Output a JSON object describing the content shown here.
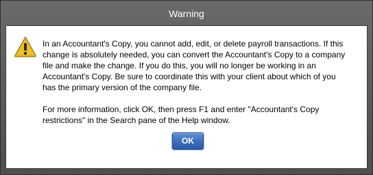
{
  "window": {
    "title": "Warning"
  },
  "icon": {
    "name": "warning-icon",
    "color": "#e1b219"
  },
  "message": {
    "paragraph1_lines": [
      "In an Accountant's Copy, you cannot add, edit, or delete payroll transactions. If this",
      "change is absolutely needed, you can convert the Accountant's Copy to a company",
      "file and make the change. If you do this, you will no longer be working in an",
      "Accountant's Copy. Be sure to coordinate this with your client about which of you",
      "has the primary version of the company file."
    ],
    "paragraph2_lines": [
      "For more information, click OK, then press F1 and enter \"Accountant's Copy",
      "restrictions\" in the Search pane of the Help window."
    ]
  },
  "buttons": {
    "ok_label": "OK"
  }
}
